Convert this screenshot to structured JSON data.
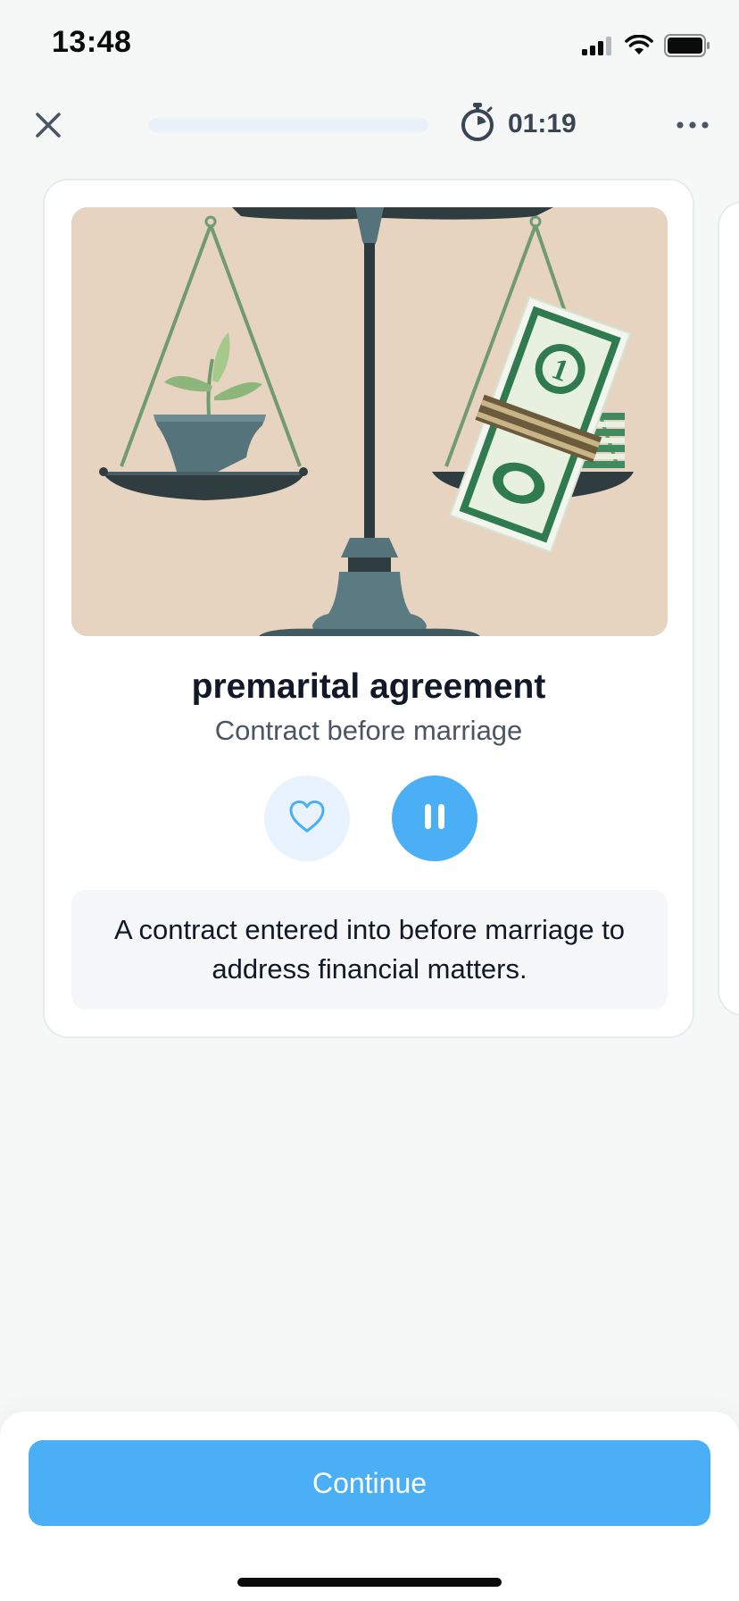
{
  "status_bar": {
    "time": "13:48",
    "icons": [
      "signal-icon",
      "wifi-icon",
      "battery-icon"
    ]
  },
  "header": {
    "close_icon": "close-icon",
    "progress": 0.0,
    "timer_icon": "stopwatch-icon",
    "timer": "01:19",
    "more_icon": "more-horizontal-icon"
  },
  "card": {
    "illustration": "scale-balancing-plant-and-money",
    "term": "premarital agreement",
    "subtitle": "Contract before marriage",
    "favorite_icon": "heart-icon",
    "pause_icon": "pause-icon",
    "definition": "A contract entered into before marriage to address financial matters."
  },
  "footer": {
    "continue_label": "Continue"
  },
  "colors": {
    "accent": "#4aaff5",
    "accent_light": "#e9f3fd",
    "background": "#f6f8f8",
    "card_border": "#e7ebef",
    "illustration_bg": "#e6d4c1"
  }
}
